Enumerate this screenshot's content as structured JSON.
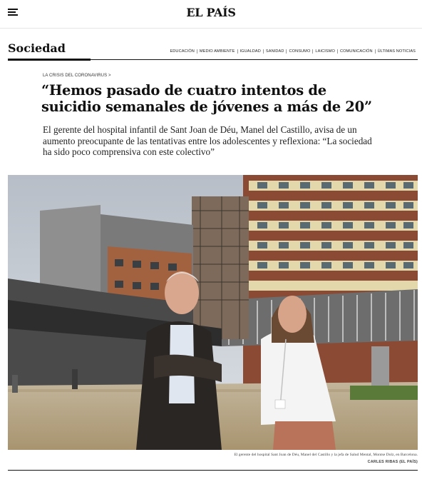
{
  "header": {
    "logo": "EL PAÍS",
    "menu_icon": "hamburger-menu-icon"
  },
  "section": {
    "title": "Sociedad",
    "nav": [
      "EDUCACIÓN",
      "MEDIO AMBIENTE",
      "IGUALDAD",
      "SANIDAD",
      "CONSUMO",
      "LAICISMO",
      "COMUNICACIÓN",
      "ÚLTIMAS NOTICIAS"
    ]
  },
  "article": {
    "kicker": "LA CRISIS DEL CORONAVIRUS >",
    "headline": "“Hemos pasado de cuatro intentos de suicidio semanales de jóvenes a más de 20”",
    "subhead": "El gerente del hospital infantil de Sant Joan de Déu, Manel del Castillo, avisa de un aumento preocupante de las tentativas entre los adolescentes y reflexiona: “La sociedad ha sido poco comprensiva con este colectivo”",
    "photo_caption": "El gerente del hospital Sant Joan de Déu, Manel del Castillo y la jefa de Salud Mental, Montse Dolz, en Barcelona.",
    "photo_credit": "CARLES RIBAS (EL PAÍS)"
  },
  "colors": {
    "sky": "#c9cfd6",
    "brick": "#8a4a34",
    "facade_light": "#e3d7ac",
    "concrete": "#8f8f8f",
    "plaza": "#b9a98a"
  }
}
